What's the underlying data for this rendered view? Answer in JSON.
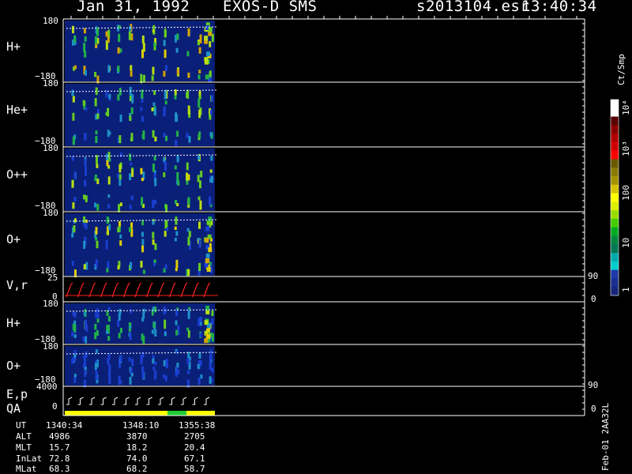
{
  "header": {
    "date": "Jan 31, 1992",
    "instrument": "EXOS-D SMS",
    "file": "s2013104.esr",
    "time": "13:40:34"
  },
  "panels": [
    {
      "id": "h-plus-1",
      "label": "H+",
      "top_tick": "180",
      "bottom_tick": "−180"
    },
    {
      "id": "he-plus",
      "label": "He+",
      "top_tick": "180",
      "bottom_tick": "−180"
    },
    {
      "id": "o-plusplus",
      "label": "O++",
      "top_tick": "180",
      "bottom_tick": "−180"
    },
    {
      "id": "o-plus-1",
      "label": "O+",
      "top_tick": "180",
      "bottom_tick": "−180"
    },
    {
      "id": "vr",
      "label": "V,r",
      "top_tick": "25",
      "bottom_tick": "0",
      "right_top": "90",
      "right_bottom": "0"
    },
    {
      "id": "h-plus-2",
      "label": "H+",
      "top_tick": "180",
      "bottom_tick": "−180"
    },
    {
      "id": "o-plus-2",
      "label": "O+",
      "top_tick": "180",
      "bottom_tick": "−180"
    },
    {
      "id": "ep",
      "label": "E,p",
      "top_tick": "4000",
      "bottom_tick": "0",
      "right_top": "90",
      "right_bottom": "0"
    }
  ],
  "qa_label": "QA",
  "colorbar": {
    "unit": "Ct/Smp",
    "ticks": [
      "10⁴",
      "10³",
      "100",
      "10",
      "1"
    ]
  },
  "orbit": {
    "rows": [
      {
        "name": "UT",
        "values": [
          "1340:34",
          "1348:10",
          "1355:38"
        ]
      },
      {
        "name": "ALT",
        "values": [
          "4986",
          "3870",
          "2705"
        ]
      },
      {
        "name": "MLT",
        "values": [
          "15.7",
          "18.2",
          "20.4"
        ]
      },
      {
        "name": "InLat",
        "values": [
          "72.8",
          "74.0",
          "67.1"
        ]
      },
      {
        "name": "MLat",
        "values": [
          "68.3",
          "68.2",
          "58.7"
        ]
      }
    ]
  },
  "footer_id": "Feb-01 2AA32L",
  "colors": {
    "background": "#000000",
    "plot_fill": "#0a1f78",
    "axis": "#ffffff",
    "trace_red": "#ff2020",
    "qa_yellow": "#ffff00",
    "qa_green": "#22cc33"
  },
  "chart_data": {
    "type": "heatmap",
    "title": "Jan 31, 1992 EXOS-D SMS",
    "x_ticks_ut": [
      "1340:34",
      "1348:10",
      "1355:38"
    ],
    "panels": [
      "H+",
      "He+",
      "O++",
      "O+",
      "V,r",
      "H+",
      "O+",
      "E,p"
    ],
    "y_range_angle": [
      -180,
      180
    ],
    "vr_range": [
      0,
      25
    ],
    "ep_range": [
      0,
      4000
    ],
    "colorbar_ticks": [
      "1",
      "10",
      "100",
      "10³",
      "10⁴"
    ],
    "colorbar_unit": "Ct/Smp",
    "grid": false
  }
}
